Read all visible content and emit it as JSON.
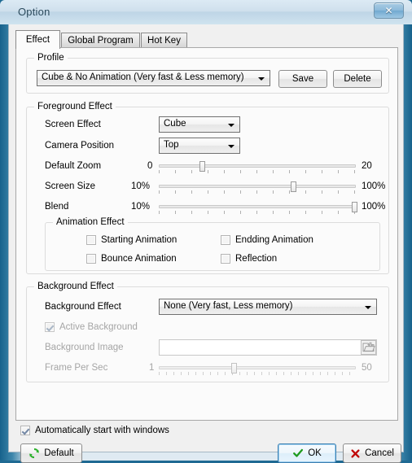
{
  "window": {
    "title": "Option",
    "close_label": "✕",
    "close_icon": "close-icon"
  },
  "tabs": [
    {
      "label": "Effect",
      "selected": true
    },
    {
      "label": "Global Program",
      "selected": false
    },
    {
      "label": "Hot Key",
      "selected": false
    }
  ],
  "profile": {
    "group_label": "Profile",
    "combo_value": "Cube & No Animation (Very fast & Less memory)",
    "save_label": "Save",
    "delete_label": "Delete"
  },
  "foreground": {
    "group_label": "Foreground Effect",
    "screen_effect_label": "Screen Effect",
    "screen_effect_value": "Cube",
    "camera_position_label": "Camera Position",
    "camera_position_value": "Top",
    "default_zoom": {
      "label": "Default Zoom",
      "min_label": "0",
      "max_label": "20",
      "min": 0,
      "max": 20,
      "value": 4,
      "percent": 22
    },
    "screen_size": {
      "label": "Screen Size",
      "min_label": "10%",
      "max_label": "100%",
      "min": 10,
      "max": 100,
      "value": 71,
      "percent": 68
    },
    "blend": {
      "label": "Blend",
      "min_label": "10%",
      "max_label": "100%",
      "min": 10,
      "max": 100,
      "value": 100,
      "percent": 99
    },
    "animation": {
      "group_label": "Animation Effect",
      "items": [
        {
          "label": "Starting Animation",
          "checked": false
        },
        {
          "label": "Endding Animation",
          "checked": false
        },
        {
          "label": "Bounce Animation",
          "checked": false
        },
        {
          "label": "Reflection",
          "checked": false
        }
      ]
    }
  },
  "background": {
    "group_label": "Background Effect",
    "effect_label": "Background Effect",
    "effect_value": "None (Very fast, Less memory)",
    "active_background_label": "Active Background",
    "active_background_checked": true,
    "image_label": "Background Image",
    "image_value": "",
    "browse_icon": "folder-open-icon",
    "fps": {
      "label": "Frame Per Sec",
      "min_label": "1",
      "max_label": "50",
      "min": 1,
      "max": 50,
      "value": 19,
      "percent": 38
    }
  },
  "footer": {
    "autostart_label": "Automatically start with windows",
    "autostart_checked": true,
    "default_label": "Default",
    "default_icon": "refresh-icon",
    "ok_label": "OK",
    "ok_icon": "check-icon",
    "cancel_label": "Cancel",
    "cancel_icon": "x-icon"
  },
  "colors": {
    "accent": "#1f6a93",
    "focus": "#3c7fb1",
    "ok_check": "#1e9b1e",
    "cancel_x": "#c00000",
    "refresh_green": "#2bb02b"
  }
}
